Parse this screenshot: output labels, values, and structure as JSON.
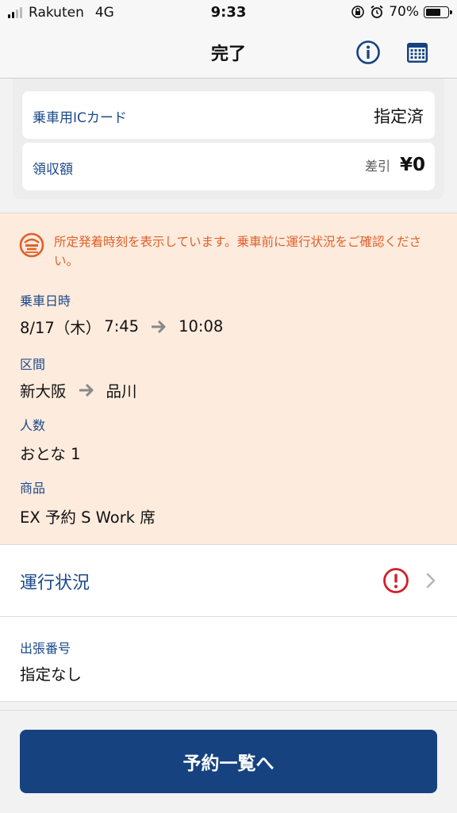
{
  "status_bar": {
    "carrier": "Rakuten",
    "network": "4G",
    "time": "9:33",
    "battery_percent": "70%",
    "battery_level": 0.7
  },
  "nav": {
    "title": "完了",
    "info_icon": "info-icon",
    "calendar_icon": "calendar-icon"
  },
  "card_info": {
    "ic_card_label": "乗車用ICカード",
    "ic_card_value": "指定済",
    "receipt_label": "領収額",
    "receipt_sub": "差引",
    "receipt_amount": "¥0"
  },
  "notice": {
    "icon": "train-delay-icon",
    "text": "所定発着時刻を表示しています。乗車前に運行状況をご確認ください。"
  },
  "ride": {
    "datetime_label": "乗車日時",
    "date": "8/17（木）",
    "depart_time": "7:45",
    "arrive_time": "10:08",
    "section_label": "区間",
    "from_station": "新大阪",
    "to_station": "品川",
    "passengers_label": "人数",
    "passengers_value": "おとな 1",
    "product_label": "商品",
    "product_value": "EX 予約 S Work 席"
  },
  "operation_status": {
    "label": "運行状況",
    "alert_icon": "alert-icon"
  },
  "business_trip": {
    "label": "出張番号",
    "value": "指定なし"
  },
  "footer": {
    "button_label": "予約一覧へ"
  },
  "colors": {
    "accent_navy": "#16427f",
    "label_blue": "#1c4a8a",
    "notice_bg": "#fdebdd",
    "notice_text": "#e0602a",
    "alert_red": "#d0202a"
  }
}
